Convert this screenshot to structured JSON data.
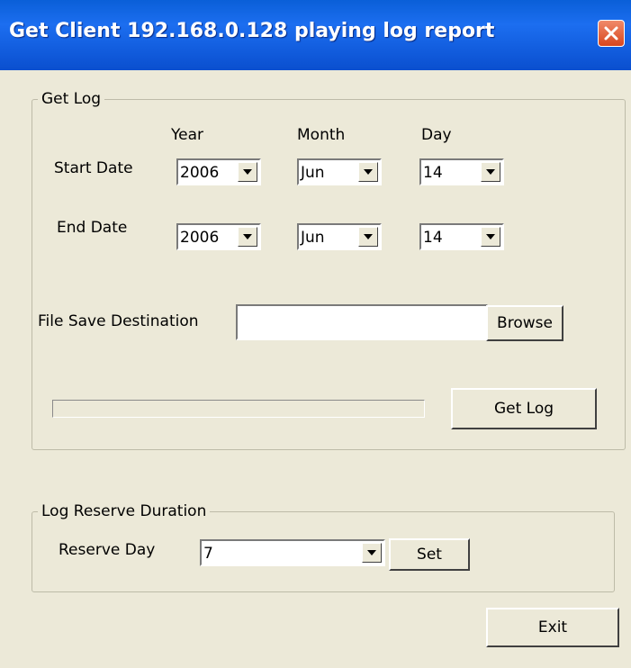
{
  "window": {
    "title": "Get Client 192.168.0.128 playing log report"
  },
  "get_log_group": {
    "legend": "Get Log",
    "col_year": "Year",
    "col_month": "Month",
    "col_day": "Day",
    "start_date_label": "Start Date",
    "end_date_label": "End Date",
    "start": {
      "year": "2006",
      "month": "Jun",
      "day": "14"
    },
    "end": {
      "year": "2006",
      "month": "Jun",
      "day": "14"
    },
    "file_save_label": "File Save Destination",
    "file_save_value": "",
    "browse_label": "Browse",
    "progress": 0,
    "get_log_label": "Get Log"
  },
  "reserve_group": {
    "legend": "Log Reserve Duration",
    "reserve_day_label": "Reserve Day",
    "reserve_day_value": "7",
    "set_label": "Set"
  },
  "exit_label": "Exit",
  "icons": {
    "close": "close-icon",
    "dropdown": "chevron-down-icon"
  },
  "colors": {
    "titlebar": "#0a5fd8",
    "close": "#d8461e",
    "dialog_bg": "#ece9d8"
  }
}
